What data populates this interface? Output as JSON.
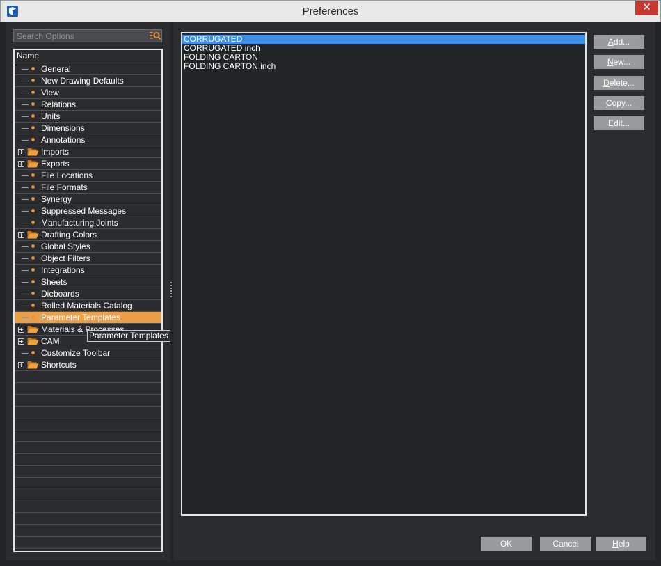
{
  "window": {
    "title": "Preferences",
    "close_glyph": "✕"
  },
  "search": {
    "placeholder": "Search Options",
    "value": ""
  },
  "tree": {
    "header": "Name",
    "items": [
      {
        "label": "General",
        "type": "leaf"
      },
      {
        "label": "New Drawing Defaults",
        "type": "leaf"
      },
      {
        "label": "View",
        "type": "leaf"
      },
      {
        "label": "Relations",
        "type": "leaf"
      },
      {
        "label": "Units",
        "type": "leaf"
      },
      {
        "label": "Dimensions",
        "type": "leaf"
      },
      {
        "label": "Annotations",
        "type": "leaf"
      },
      {
        "label": "Imports",
        "type": "folder"
      },
      {
        "label": "Exports",
        "type": "folder"
      },
      {
        "label": "File Locations",
        "type": "leaf"
      },
      {
        "label": "File Formats",
        "type": "leaf"
      },
      {
        "label": "Synergy",
        "type": "leaf"
      },
      {
        "label": "Suppressed Messages",
        "type": "leaf"
      },
      {
        "label": "Manufacturing Joints",
        "type": "leaf"
      },
      {
        "label": "Drafting Colors",
        "type": "folder"
      },
      {
        "label": "Global Styles",
        "type": "leaf"
      },
      {
        "label": "Object Filters",
        "type": "leaf"
      },
      {
        "label": "Integrations",
        "type": "leaf"
      },
      {
        "label": "Sheets",
        "type": "leaf"
      },
      {
        "label": "Dieboards",
        "type": "leaf"
      },
      {
        "label": "Rolled Materials Catalog",
        "type": "leaf"
      },
      {
        "label": "Parameter Templates",
        "type": "leaf",
        "selected": true
      },
      {
        "label": "Materials & Processes",
        "type": "folder"
      },
      {
        "label": "CAM",
        "type": "folder"
      },
      {
        "label": "Customize Toolbar",
        "type": "leaf"
      },
      {
        "label": "Shortcuts",
        "type": "folder"
      }
    ],
    "empty_rows": 15
  },
  "tooltip": "Parameter Templates",
  "templates": [
    {
      "label": "CORRUGATED",
      "selected": true
    },
    {
      "label": "CORRUGATED inch"
    },
    {
      "label": "FOLDING CARTON"
    },
    {
      "label": "FOLDING CARTON inch"
    }
  ],
  "side_buttons": {
    "add": {
      "mnemonic": "A",
      "rest": "dd..."
    },
    "new": {
      "mnemonic": "N",
      "rest": "ew..."
    },
    "delete": {
      "mnemonic": "D",
      "rest": "elete..."
    },
    "copy": {
      "mnemonic": "C",
      "rest": "opy..."
    },
    "edit": {
      "mnemonic": "E",
      "rest": "dit..."
    }
  },
  "footer": {
    "ok": "OK",
    "cancel": "Cancel",
    "help": {
      "mnemonic": "H",
      "rest": "elp"
    }
  },
  "colors": {
    "accent_orange": "#eb9f48",
    "selection_blue": "#3d8ee7",
    "close_red": "#c7392e",
    "background": "#2b2c2f"
  }
}
